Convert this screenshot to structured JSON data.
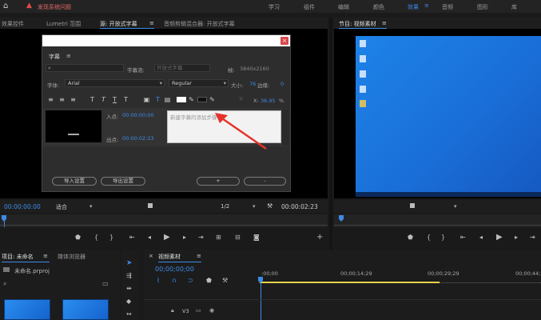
{
  "topbar": {
    "warning_text": "发现系统问题",
    "workspaces": [
      "学习",
      "组件",
      "编辑",
      "颜色",
      "效果",
      "音频",
      "图形",
      "库"
    ],
    "active_workspace": "效果"
  },
  "source_panel": {
    "tabs": [
      "效果控件",
      "Lumetri 范围",
      "源: 开放式字幕",
      "音频剪辑混合器: 开放式字幕"
    ],
    "active_tab": "源: 开放式字幕",
    "timecode_in": "00:00:00:00",
    "fit": "适合",
    "page": "1/2",
    "timecode_out": "00:00:02:23"
  },
  "caption_dialog": {
    "panel_title": "字幕",
    "stream_label": "字幕流:",
    "stream_value": "开放式字幕",
    "frame_label": "帧:",
    "frame_value": "3840x2160",
    "font_label": "字体:",
    "font_value": "Arial",
    "style_value": "Regular",
    "size_label": "大小:",
    "size_value": "76",
    "edge_label": "边缘:",
    "edge_value": "0",
    "x_label": "X:",
    "x_value": "36.95",
    "percent": "%",
    "in_label": "入点:",
    "in_value": "00:00:00:00",
    "out_label": "出点:",
    "out_value": "00:00:02:23",
    "text_placeholder": "新建字幕的添加步骤",
    "btn_import": "导入设置",
    "btn_export": "导出设置",
    "btn_add": "+",
    "btn_remove": "-"
  },
  "program_panel": {
    "title": "节目: 视频素材"
  },
  "project_panel": {
    "tabs": [
      "项目: 未命名",
      "媒体浏览器"
    ],
    "project_name": "未命名.prproj"
  },
  "timeline_panel": {
    "title": "视频素材",
    "timecode": "00;00;00;00",
    "ruler": [
      ":00;00",
      "00;00;14;29",
      "00;00;29;29",
      "00;00;44;28"
    ],
    "track": "V3"
  },
  "colors": {
    "accent": "#3d8ae6",
    "desktop": "#1a6fd8",
    "close": "#d84a4a",
    "timeline_bar": "#e7d34a"
  }
}
